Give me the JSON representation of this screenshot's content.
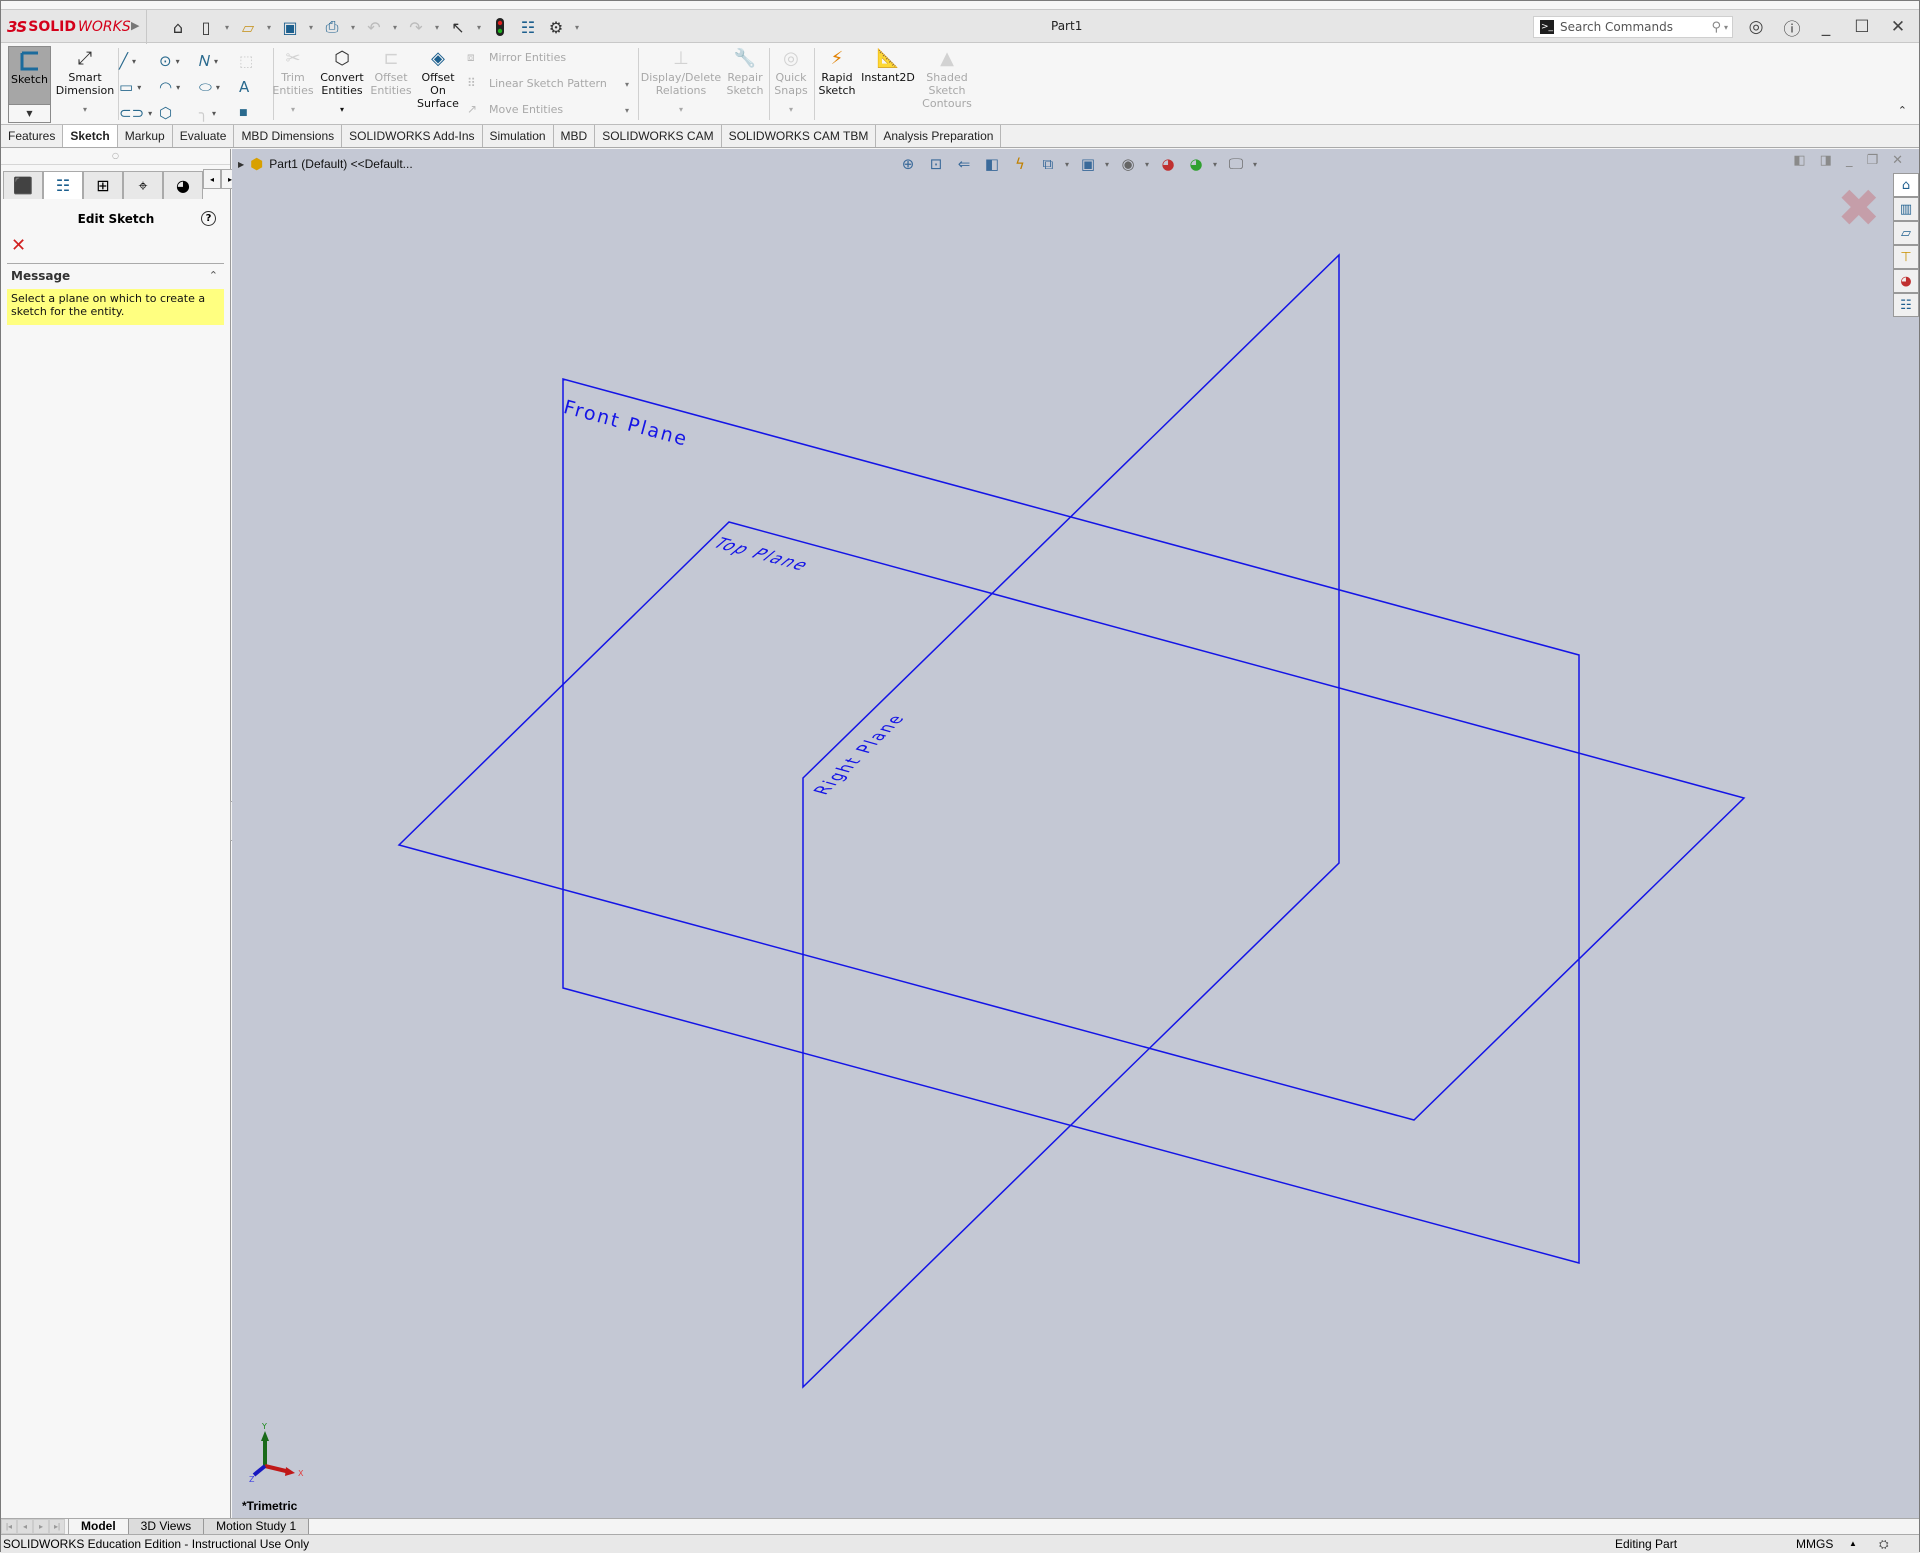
{
  "app": {
    "brand": "SOLIDWORKS",
    "brand_prefix": "3S",
    "brand_bold": "SOLID",
    "brand_light": "WORKS",
    "document_title": "Part1",
    "search": {
      "placeholder": "Search Commands"
    }
  },
  "quick_access": [
    {
      "name": "home-icon",
      "glyph": "⌂"
    },
    {
      "name": "new-document-icon",
      "glyph": "🗋"
    },
    {
      "name": "open-icon",
      "glyph": "📂"
    },
    {
      "name": "save-icon",
      "glyph": "💾"
    },
    {
      "name": "print-icon",
      "glyph": "🖶"
    },
    {
      "name": "undo-icon",
      "glyph": "↶"
    },
    {
      "name": "redo-icon",
      "glyph": "↷"
    },
    {
      "name": "select-icon",
      "glyph": "↖"
    },
    {
      "name": "rebuild-icon",
      "glyph": "⬮"
    },
    {
      "name": "file-properties-icon",
      "glyph": "☰"
    },
    {
      "name": "options-icon",
      "glyph": "⚙"
    }
  ],
  "command_manager": {
    "sketch": "Sketch",
    "smart_dimension": [
      "Smart",
      "Dimension"
    ],
    "trim_entities": [
      "Trim",
      "Entities"
    ],
    "convert_entities": [
      "Convert",
      "Entities"
    ],
    "offset_entities": [
      "Offset",
      "Entities"
    ],
    "offset_on_surface": [
      "Offset",
      "On",
      "Surface"
    ],
    "mirror_entities": "Mirror Entities",
    "linear_sketch_pattern": "Linear Sketch Pattern",
    "move_entities": "Move Entities",
    "display_delete_relations": [
      "Display/Delete",
      "Relations"
    ],
    "repair_sketch": [
      "Repair",
      "Sketch"
    ],
    "quick_snaps": [
      "Quick",
      "Snaps"
    ],
    "rapid_sketch": [
      "Rapid",
      "Sketch"
    ],
    "instant2d": "Instant2D",
    "shaded_sketch_contours": [
      "Shaded",
      "Sketch",
      "Contours"
    ]
  },
  "tabs": [
    {
      "label": "Features",
      "active": false
    },
    {
      "label": "Sketch",
      "active": true
    },
    {
      "label": "Markup",
      "active": false
    },
    {
      "label": "Evaluate",
      "active": false
    },
    {
      "label": "MBD Dimensions",
      "active": false
    },
    {
      "label": "SOLIDWORKS Add-Ins",
      "active": false
    },
    {
      "label": "Simulation",
      "active": false
    },
    {
      "label": "MBD",
      "active": false
    },
    {
      "label": "SOLIDWORKS CAM",
      "active": false
    },
    {
      "label": "SOLIDWORKS CAM TBM",
      "active": false
    },
    {
      "label": "Analysis Preparation",
      "active": false
    }
  ],
  "property_manager": {
    "title": "Edit Sketch",
    "message_header": "Message",
    "message": "Select a plane on which to create a sketch for the entity."
  },
  "graphics": {
    "tree_flyout": "Part1 (Default) <<Default...",
    "view_name": "*Trimetric",
    "plane_color": "#1414e6",
    "background": "#c4c8d4",
    "planes": [
      {
        "label": "Front Plane"
      },
      {
        "label": "Top Plane"
      },
      {
        "label": "Right Plane"
      }
    ],
    "triad": {
      "x": "X",
      "y": "Y",
      "z": "Z"
    }
  },
  "bottom_tabs": [
    {
      "label": "Model",
      "active": true
    },
    {
      "label": "3D Views",
      "active": false
    },
    {
      "label": "Motion Study 1",
      "active": false
    }
  ],
  "status": {
    "left": "SOLIDWORKS Education Edition - Instructional Use Only",
    "mode": "Editing Part",
    "units": "MMGS"
  }
}
